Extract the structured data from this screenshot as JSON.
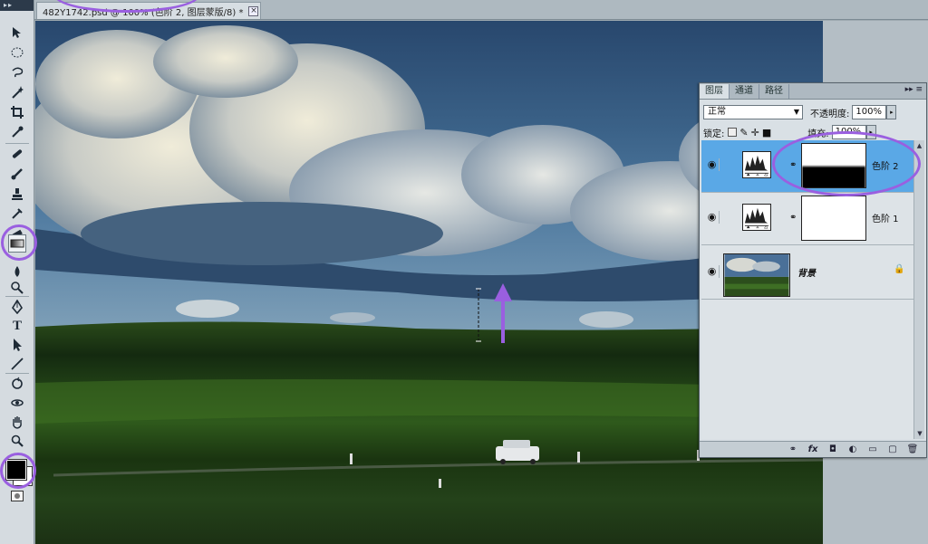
{
  "document": {
    "tab_title": "482Y1742.psd @ 100% (色阶 2, 图层蒙版/8) *",
    "close_glyph": "×"
  },
  "toolbar": {
    "grip": "▸▸",
    "tools": [
      "move-tool-icon",
      "elliptical-marquee-icon",
      "lasso-icon",
      "magic-wand-icon",
      "crop-icon",
      "eyedropper-icon",
      "brush-icon",
      "pencil-icon",
      "stamp-icon",
      "history-brush-icon",
      "gradient-tool-icon",
      "blur-icon",
      "dodge-icon",
      "pen-icon",
      "type-icon",
      "path-select-icon",
      "line-icon",
      "3d-rotate-icon",
      "3d-orbit-icon",
      "hand-icon",
      "zoom-icon"
    ],
    "type_glyph": "T",
    "foreground_color": "#000000",
    "background_color": "#ffffff"
  },
  "layers_panel": {
    "tabs": [
      "图层",
      "通道",
      "路径"
    ],
    "menu_glyph": "▸▸ ≡",
    "blend_mode": "正常",
    "opacity_label": "不透明度:",
    "opacity_value": "100%",
    "lock_label": "锁定:",
    "fill_label": "填充:",
    "fill_value": "100%",
    "layers": [
      {
        "name": "色阶 2",
        "selected": true
      },
      {
        "name": "色阶 1",
        "selected": false
      },
      {
        "name": "背景",
        "selected": false
      }
    ],
    "footer_icons": [
      "link-icon",
      "fx-icon",
      "mask-icon",
      "adjustment-icon",
      "group-icon",
      "new-layer-icon",
      "trash-icon"
    ],
    "footer_glyphs": [
      "⚭",
      "fx",
      "◘",
      "◐",
      "▭",
      "▢",
      "🗑"
    ]
  },
  "colors": {
    "annotation": "#9a5fe0",
    "selected_layer": "#5aa8e6"
  }
}
